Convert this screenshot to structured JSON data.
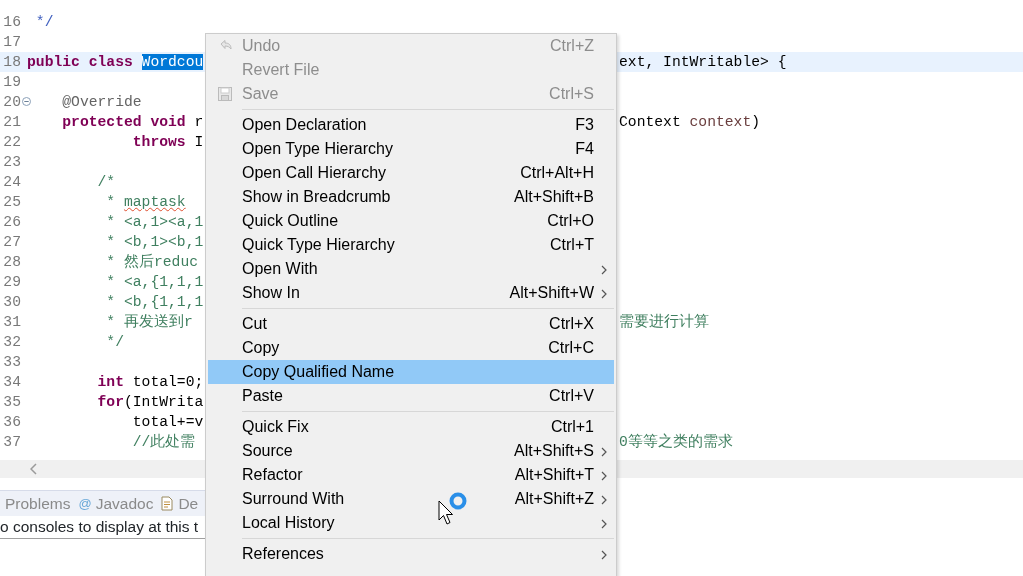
{
  "editor": {
    "lines": [
      {
        "number": "16",
        "current": false,
        "left": [
          {
            "text": " */",
            "kind": "doc"
          }
        ]
      },
      {
        "number": "17",
        "current": false
      },
      {
        "number": "18",
        "current": true,
        "left": [
          {
            "text": "public class ",
            "kind": "keyword"
          },
          {
            "text": "Wordcou",
            "kind": "selected"
          }
        ],
        "right": [
          {
            "text": "ext, IntWritable> {",
            "kind": "plain"
          }
        ]
      },
      {
        "number": "19",
        "current": false
      },
      {
        "number": "20",
        "current": false,
        "fold": true,
        "left": [
          {
            "text": "    @Override",
            "kind": "annotation"
          }
        ]
      },
      {
        "number": "21",
        "current": false,
        "left": [
          {
            "text": "    protected void ",
            "kind": "keyword"
          },
          {
            "text": "r",
            "kind": "plain"
          }
        ],
        "right": [
          {
            "text": "Context ",
            "kind": "plain"
          },
          {
            "text": "context",
            "kind": "param"
          },
          {
            "text": ")",
            "kind": "plain"
          }
        ]
      },
      {
        "number": "22",
        "current": false,
        "left": [
          {
            "text": "            throws ",
            "kind": "keyword"
          },
          {
            "text": "I",
            "kind": "plain"
          }
        ]
      },
      {
        "number": "23",
        "current": false
      },
      {
        "number": "24",
        "current": false,
        "left": [
          {
            "text": "        /*",
            "kind": "comment"
          }
        ]
      },
      {
        "number": "25",
        "current": false,
        "left": [
          {
            "text": "         * ",
            "kind": "comment"
          },
          {
            "text": "maptask",
            "kind": "misspelled"
          }
        ]
      },
      {
        "number": "26",
        "current": false,
        "left": [
          {
            "text": "         * <a,1><a,1",
            "kind": "comment"
          }
        ]
      },
      {
        "number": "27",
        "current": false,
        "left": [
          {
            "text": "         * <b,1><b,1",
            "kind": "comment"
          }
        ]
      },
      {
        "number": "28",
        "current": false,
        "left": [
          {
            "text": "         * 然后reduc",
            "kind": "comment"
          }
        ]
      },
      {
        "number": "29",
        "current": false,
        "left": [
          {
            "text": "         * <a,{1,1,1",
            "kind": "comment"
          }
        ]
      },
      {
        "number": "30",
        "current": false,
        "left": [
          {
            "text": "         * <b,{1,1,1",
            "kind": "comment"
          }
        ]
      },
      {
        "number": "31",
        "current": false,
        "left": [
          {
            "text": "         * 再发送到r",
            "kind": "comment"
          }
        ],
        "right": [
          {
            "text": "需要进行计算",
            "kind": "comment"
          }
        ]
      },
      {
        "number": "32",
        "current": false,
        "left": [
          {
            "text": "         */",
            "kind": "comment"
          }
        ]
      },
      {
        "number": "33",
        "current": false
      },
      {
        "number": "34",
        "current": false,
        "left": [
          {
            "text": "        int ",
            "kind": "keyword"
          },
          {
            "text": "total=0;",
            "kind": "plain"
          }
        ]
      },
      {
        "number": "35",
        "current": false,
        "left": [
          {
            "text": "        for",
            "kind": "keyword"
          },
          {
            "text": "(IntWrita",
            "kind": "plain"
          }
        ]
      },
      {
        "number": "36",
        "current": false,
        "left": [
          {
            "text": "            total+=v",
            "kind": "plain"
          }
        ]
      },
      {
        "number": "37",
        "current": false,
        "left": [
          {
            "text": "            //此处需",
            "kind": "comment"
          }
        ],
        "right": [
          {
            "text": "0等等之类的需求",
            "kind": "comment"
          }
        ]
      }
    ]
  },
  "bottom_panel": {
    "tabs": [
      {
        "label": "Problems"
      },
      {
        "icon": "@",
        "label": "Javadoc"
      },
      {
        "label": "De"
      }
    ],
    "console_message": "o consoles to display at this t"
  },
  "context_menu": {
    "items": [
      {
        "kind": "undo",
        "label": "Undo",
        "shortcut": "Ctrl+Z",
        "disabled": true,
        "selected": false,
        "submenu": false
      },
      {
        "kind": "item",
        "label": "Revert File",
        "disabled": true,
        "selected": false,
        "submenu": false
      },
      {
        "kind": "save",
        "label": "Save",
        "shortcut": "Ctrl+S",
        "disabled": true,
        "selected": false,
        "submenu": false
      },
      {
        "kind": "separator"
      },
      {
        "kind": "item",
        "label": "Open Declaration",
        "shortcut": "F3",
        "disabled": false,
        "selected": false,
        "submenu": false
      },
      {
        "kind": "item",
        "label": "Open Type Hierarchy",
        "shortcut": "F4",
        "disabled": false,
        "selected": false,
        "submenu": false
      },
      {
        "kind": "item",
        "label": "Open Call Hierarchy",
        "shortcut": "Ctrl+Alt+H",
        "disabled": false,
        "selected": false,
        "submenu": false
      },
      {
        "kind": "item",
        "label": "Show in Breadcrumb",
        "shortcut": "Alt+Shift+B",
        "disabled": false,
        "selected": false,
        "submenu": false
      },
      {
        "kind": "item",
        "label": "Quick Outline",
        "shortcut": "Ctrl+O",
        "disabled": false,
        "selected": false,
        "submenu": false
      },
      {
        "kind": "item",
        "label": "Quick Type Hierarchy",
        "shortcut": "Ctrl+T",
        "disabled": false,
        "selected": false,
        "submenu": false
      },
      {
        "kind": "item",
        "label": "Open With",
        "disabled": false,
        "selected": false,
        "submenu": true
      },
      {
        "kind": "item",
        "label": "Show In",
        "shortcut": "Alt+Shift+W",
        "disabled": false,
        "selected": false,
        "submenu": true
      },
      {
        "kind": "separator"
      },
      {
        "kind": "item",
        "label": "Cut",
        "shortcut": "Ctrl+X",
        "disabled": false,
        "selected": false,
        "submenu": false
      },
      {
        "kind": "item",
        "label": "Copy",
        "shortcut": "Ctrl+C",
        "disabled": false,
        "selected": false,
        "submenu": false
      },
      {
        "kind": "item",
        "label": "Copy Qualified Name",
        "disabled": false,
        "selected": true,
        "submenu": false
      },
      {
        "kind": "item",
        "label": "Paste",
        "shortcut": "Ctrl+V",
        "disabled": false,
        "selected": false,
        "submenu": false
      },
      {
        "kind": "separator"
      },
      {
        "kind": "item",
        "label": "Quick Fix",
        "shortcut": "Ctrl+1",
        "disabled": false,
        "selected": false,
        "submenu": false
      },
      {
        "kind": "item",
        "label": "Source",
        "shortcut": "Alt+Shift+S",
        "disabled": false,
        "selected": false,
        "submenu": true
      },
      {
        "kind": "item",
        "label": "Refactor",
        "shortcut": "Alt+Shift+T",
        "disabled": false,
        "selected": false,
        "submenu": true
      },
      {
        "kind": "item",
        "label": "Surround With",
        "shortcut": "Alt+Shift+Z",
        "disabled": false,
        "selected": false,
        "submenu": true
      },
      {
        "kind": "item",
        "label": "Local History",
        "disabled": false,
        "selected": false,
        "submenu": true
      },
      {
        "kind": "separator"
      },
      {
        "kind": "item",
        "label": "References",
        "disabled": false,
        "selected": false,
        "submenu": true
      }
    ]
  }
}
